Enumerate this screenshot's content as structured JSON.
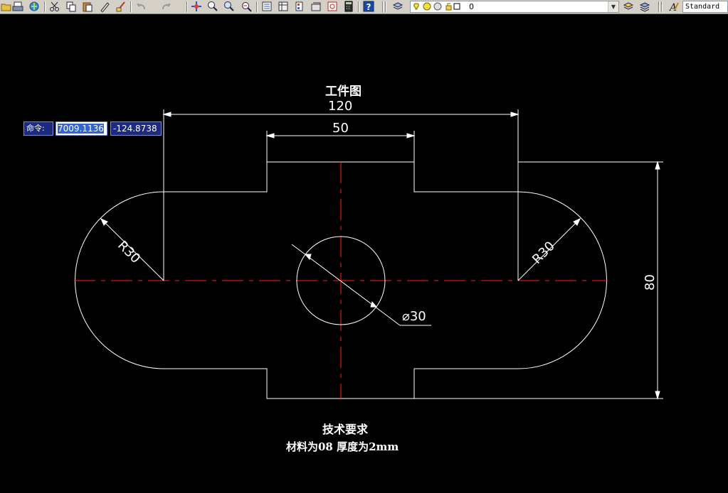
{
  "toolbar": {
    "layer_combo": {
      "current_layer": "0"
    },
    "text_style_combo": {
      "value": "Standard"
    }
  },
  "dynamic_input": {
    "prompt_label": "命令:",
    "x_value": "7009.1136",
    "y_value": "-124.8738"
  },
  "drawing": {
    "title": "工件图",
    "dimensions": {
      "overall_width": "120",
      "tab_width": "50",
      "radius_left": "R30",
      "radius_right": "R30",
      "hole_diameter": "⌀30",
      "overall_height": "80"
    },
    "notes_title": "技术要求",
    "notes_body": "材料为08 厚度为2mm"
  },
  "colors": {
    "background": "#000000",
    "geometry": "#ffffff",
    "centerline": "#ff0000",
    "dyn_input_bg": "#1c2a80",
    "toolbar_bg": "#d4d0c8"
  }
}
